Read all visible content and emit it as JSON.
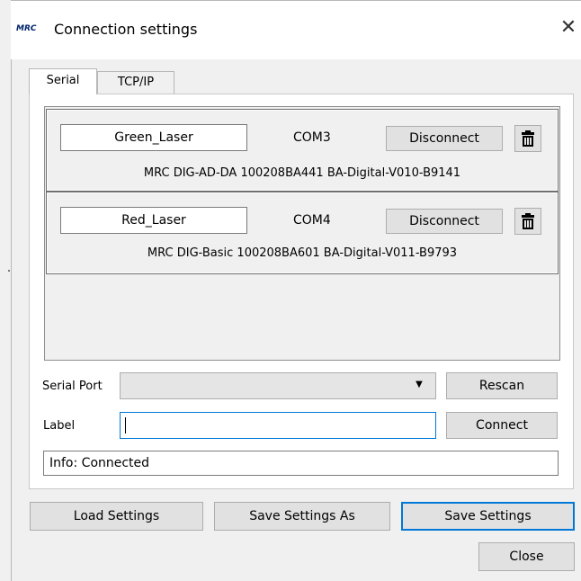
{
  "window": {
    "logo_text": "MRC",
    "title": "Connection settings",
    "close_glyph": "✕"
  },
  "tabs": [
    {
      "label": "Serial",
      "active": true
    },
    {
      "label": "TCP/IP",
      "active": false
    }
  ],
  "devices": [
    {
      "label": "Green_Laser",
      "port": "COM3",
      "action_label": "Disconnect",
      "info": "MRC DIG-AD-DA 100208BA441 BA-Digital-V010-B9141",
      "delete_icon": "trash-icon"
    },
    {
      "label": "Red_Laser",
      "port": "COM4",
      "action_label": "Disconnect",
      "info": "MRC DIG-Basic 100208BA601 BA-Digital-V011-B9793",
      "delete_icon": "trash-icon"
    }
  ],
  "serial_port": {
    "label": "Serial Port",
    "value": "",
    "rescan_label": "Rescan"
  },
  "label_field": {
    "label": "Label",
    "value": "",
    "connect_label": "Connect"
  },
  "info": {
    "text": "Info: Connected"
  },
  "buttons": {
    "load": "Load Settings",
    "save_as": "Save Settings As",
    "save": "Save Settings",
    "close": "Close"
  },
  "colors": {
    "focus_accent": "#0078d7",
    "window_bg": "#f0f0f0",
    "button_bg": "#e1e1e1"
  }
}
